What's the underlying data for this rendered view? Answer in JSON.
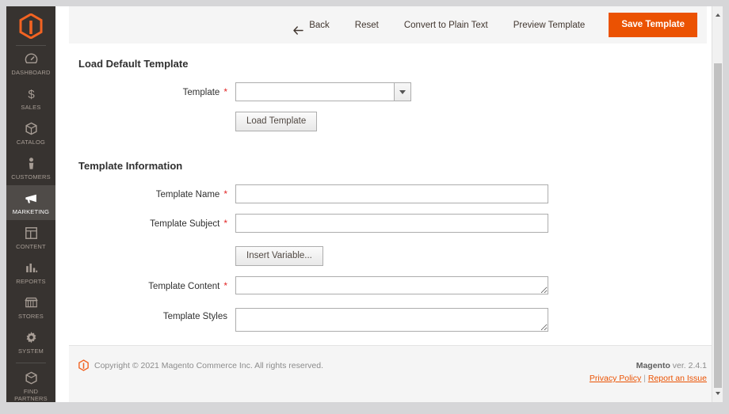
{
  "sidebar": {
    "logo_name": "magento-logo",
    "items": [
      {
        "label": "DASHBOARD",
        "icon": "dashboard-icon",
        "active": false
      },
      {
        "label": "SALES",
        "icon": "dollar-icon",
        "active": false
      },
      {
        "label": "CATALOG",
        "icon": "box-icon",
        "active": false
      },
      {
        "label": "CUSTOMERS",
        "icon": "person-icon",
        "active": false
      },
      {
        "label": "MARKETING",
        "icon": "megaphone-icon",
        "active": true
      },
      {
        "label": "CONTENT",
        "icon": "layout-icon",
        "active": false
      },
      {
        "label": "REPORTS",
        "icon": "bar-chart-icon",
        "active": false
      },
      {
        "label": "STORES",
        "icon": "store-icon",
        "active": false
      },
      {
        "label": "SYSTEM",
        "icon": "gear-icon",
        "active": false
      },
      {
        "label": "FIND PARTNERS\n& EXTENSIONS",
        "icon": "package-icon",
        "active": false
      }
    ]
  },
  "toolbar": {
    "back_label": "Back",
    "back_icon": "arrow-left-icon",
    "reset_label": "Reset",
    "convert_label": "Convert to Plain Text",
    "preview_label": "Preview Template",
    "save_label": "Save Template",
    "save_color": "#eb5202"
  },
  "load_default": {
    "heading": "Load Default Template",
    "template_label": "Template",
    "template_value": "",
    "template_required": "*",
    "dropdown_icon": "chevron-down-icon",
    "load_button_label": "Load Template"
  },
  "template_information": {
    "heading": "Template Information",
    "name_label": "Template Name",
    "name_value": "",
    "name_required": "*",
    "subject_label": "Template Subject",
    "subject_value": "",
    "subject_required": "*",
    "insert_variable_label": "Insert Variable...",
    "content_label": "Template Content",
    "content_value": "",
    "content_required": "*",
    "styles_label": "Template Styles",
    "styles_value": ""
  },
  "footer": {
    "logo_name": "magento-footer-logo",
    "copyright": "Copyright © 2021 Magento Commerce Inc. All rights reserved.",
    "brand": "Magento",
    "version": " ver. 2.4.1",
    "privacy_label": "Privacy Policy",
    "separator": "|",
    "report_label": "Report an Issue",
    "link_color": "#eb5202"
  },
  "scrollbar": {
    "up_icon": "scroll-up-arrow-icon",
    "down_icon": "scroll-down-arrow-icon"
  }
}
